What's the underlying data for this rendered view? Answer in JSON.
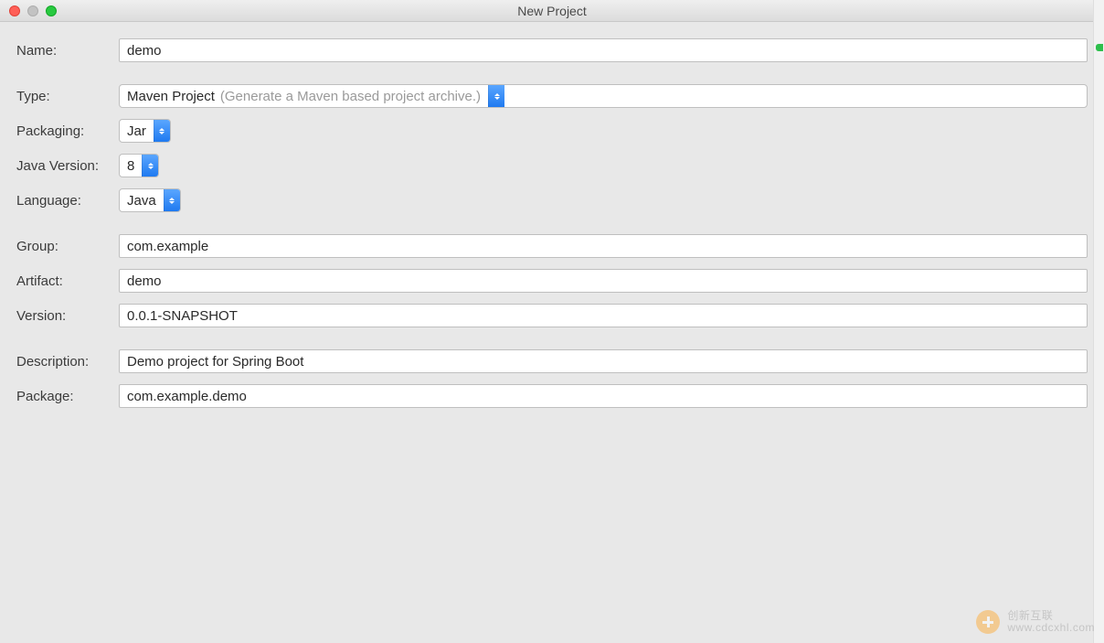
{
  "window": {
    "title": "New Project"
  },
  "labels": {
    "name": "Name:",
    "type": "Type:",
    "packaging": "Packaging:",
    "javaVersion": "Java Version:",
    "language": "Language:",
    "group": "Group:",
    "artifact": "Artifact:",
    "version": "Version:",
    "description": "Description:",
    "package": "Package:"
  },
  "fields": {
    "name": "demo",
    "type": {
      "value": "Maven Project",
      "hint": "(Generate a Maven based project archive.)"
    },
    "packaging": "Jar",
    "javaVersion": "8",
    "language": "Java",
    "group": "com.example",
    "artifact": "demo",
    "version": "0.0.1-SNAPSHOT",
    "description": "Demo project for Spring Boot",
    "package": "com.example.demo"
  },
  "watermark": {
    "line1": "创新互联",
    "line2": "www.cdcxhl.com"
  }
}
